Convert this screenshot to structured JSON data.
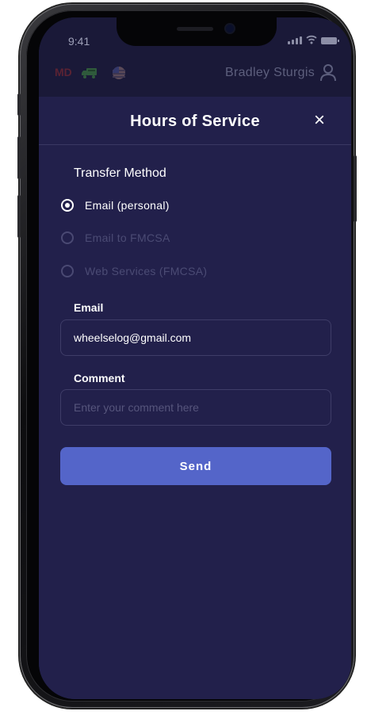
{
  "status_bar": {
    "time": "9:41",
    "icons": [
      "signal-icon",
      "wifi-icon",
      "battery-icon"
    ]
  },
  "app_header": {
    "badge": "MD",
    "badge_color": "#5a2233",
    "icons": [
      "truck-icon",
      "us-flag-icon",
      "user-icon"
    ],
    "user_name": "Bradley Sturgis"
  },
  "modal": {
    "title": "Hours of Service",
    "close_icon": "×",
    "transfer_method_label": "Transfer Method",
    "options": [
      {
        "label": "Email (personal)",
        "selected": true
      },
      {
        "label": "Email to FMCSA",
        "selected": false
      },
      {
        "label": "Web Services (FMCSA)",
        "selected": false
      }
    ],
    "email_label": "Email",
    "email_value": "wheelselog@gmail.com",
    "comment_label": "Comment",
    "comment_placeholder": "Enter your comment here",
    "send_label": "Send"
  },
  "colors": {
    "background": "#22204b",
    "accent": "#5465c9",
    "text": "#ffffff",
    "muted": "#4b4b74"
  }
}
